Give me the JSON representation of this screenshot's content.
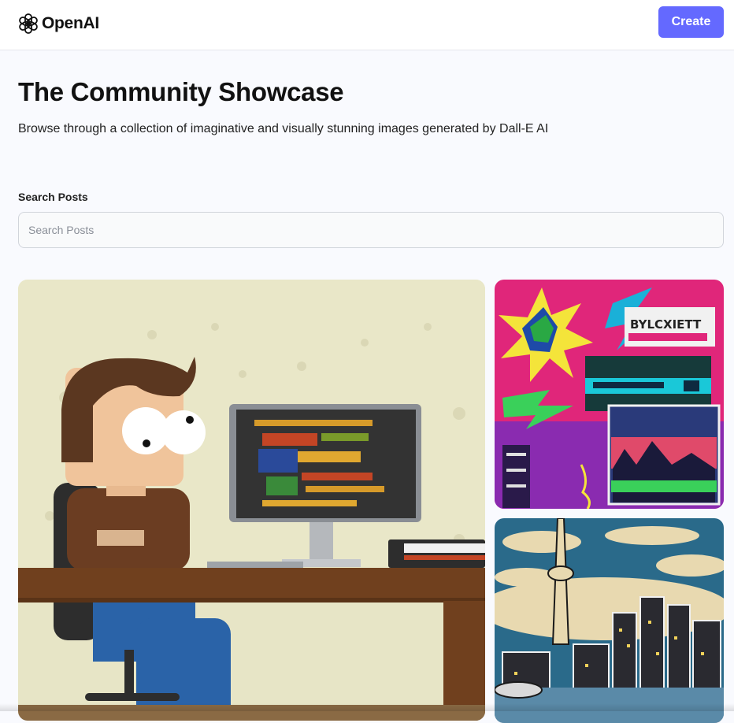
{
  "header": {
    "logo_text": "OpenAI",
    "logo_icon": "openai-knot-icon",
    "create_label": "Create",
    "create_color": "#6469ff"
  },
  "hero": {
    "title": "The Community Showcase",
    "subtitle": "Browse through a collection of imaginative and visually stunning images generated by Dall-E AI"
  },
  "search": {
    "label": "Search Posts",
    "placeholder": "Search Posts",
    "value": ""
  },
  "gallery": {
    "images": [
      {
        "subject": "cartoon-developer-at-computer"
      },
      {
        "subject": "neon-cyberpunk-collage"
      },
      {
        "subject": "cn-tower-city-skyline"
      }
    ],
    "neon_sign_text": "BYLCXIETT"
  },
  "colors": {
    "page_bg": "#f9fafe",
    "header_bg": "#ffffff",
    "accent": "#6469ff"
  }
}
